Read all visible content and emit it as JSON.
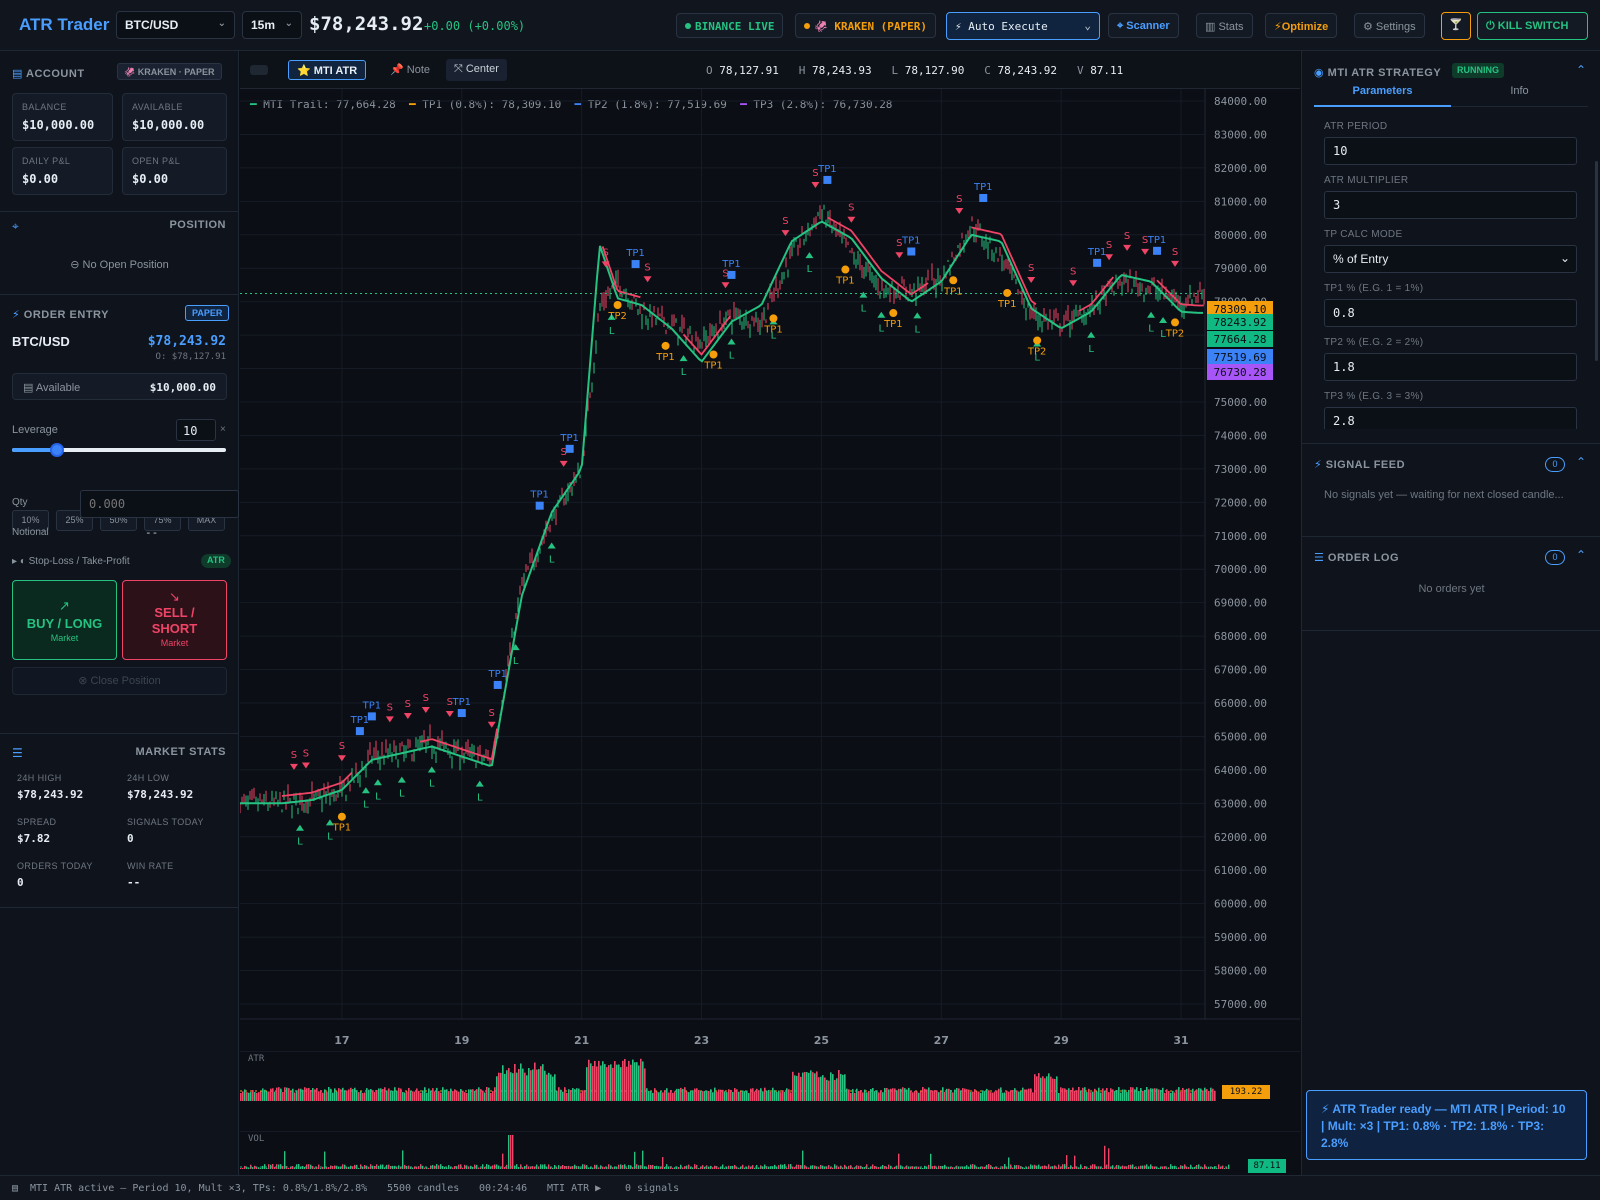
{
  "app": {
    "title": "ATR Trader",
    "symbol": "BTC/USD",
    "timeframe": "15m",
    "price": "$78,243.92",
    "change": "+0.00 (+0.00%)"
  },
  "top": {
    "binance": "BINANCE LIVE",
    "kraken": "KRAKEN (PAPER)",
    "auto_execute": "⚡ Auto Execute",
    "scanner": "Scanner",
    "stats": "Stats",
    "optimize": "Optimize",
    "settings": "Settings",
    "kill": "KILL SWITCH"
  },
  "account": {
    "title": "ACCOUNT",
    "badge": "KRAKEN · PAPER",
    "balance_l": "BALANCE",
    "balance": "$10,000.00",
    "avail_l": "AVAILABLE",
    "avail": "$10,000.00",
    "dpl_l": "DAILY P&L",
    "dpl": "$0.00",
    "opl_l": "OPEN P&L",
    "opl": "$0.00"
  },
  "position": {
    "title": "POSITION",
    "empty": "No Open Position"
  },
  "order": {
    "title": "ORDER ENTRY",
    "badge": "PAPER",
    "symbol": "BTC/USD",
    "price": "$78,243.92",
    "open": "O: $78,127.91",
    "available_l": "Available",
    "available": "$10,000.00",
    "leverage_l": "Leverage",
    "leverage": "10",
    "leverage_unit": "×",
    "pcts": [
      "10%",
      "25%",
      "50%",
      "75%",
      "MAX"
    ],
    "qty_l": "Qty",
    "qty_ph": "0.000",
    "notional_l": "Notional",
    "notional": "--",
    "sltp": "Stop-Loss / Take-Profit",
    "atr": "ATR",
    "buy": "BUY / LONG",
    "buy_sub": "Market",
    "sell1": "SELL /",
    "sell2": "SHORT",
    "sell_sub": "Market",
    "close": "Close Position"
  },
  "market": {
    "title": "MARKET STATS",
    "h_l": "24H HIGH",
    "h": "$78,243.92",
    "lo_l": "24H LOW",
    "lo": "$78,243.92",
    "sp_l": "SPREAD",
    "sp": "$7.82",
    "sig_l": "SIGNALS TODAY",
    "sig": "0",
    "ord_l": "ORDERS TODAY",
    "ord": "0",
    "wr_l": "WIN RATE",
    "wr": "--"
  },
  "toolbar": {
    "mti": "MTI ATR",
    "note": "Note",
    "center": "Center",
    "o_l": "O",
    "o": "78,127.91",
    "h_l": "H",
    "h": "78,243.93",
    "l_l": "L",
    "l": "78,127.90",
    "c_l": "C",
    "c": "78,243.92",
    "v_l": "V",
    "v": "87.11"
  },
  "legend": {
    "trail": "MTI Trail: 77,664.28",
    "tp1": "TP1 (0.8%): 78,309.10",
    "tp2": "TP2 (1.8%): 77,519.69",
    "tp3": "TP3 (2.8%): 76,730.28"
  },
  "axis": {
    "y": [
      "84000.00",
      "83000.00",
      "82000.00",
      "81000.00",
      "80000.00",
      "79000.00",
      "78000.00",
      "77000.00",
      "76000.00",
      "75000.00",
      "74000.00",
      "73000.00",
      "72000.00",
      "71000.00",
      "70000.00",
      "69000.00",
      "68000.00",
      "67000.00",
      "66000.00",
      "65000.00",
      "64000.00",
      "63000.00",
      "62000.00",
      "61000.00",
      "60000.00",
      "59000.00",
      "58000.00",
      "57000.00"
    ],
    "x": [
      "17",
      "19",
      "21",
      "23",
      "25",
      "27",
      "29",
      "31"
    ]
  },
  "tags": [
    {
      "t": "78309.10",
      "c": "#f59e0b"
    },
    {
      "t": "78243.92",
      "c": "#10b981"
    },
    {
      "t": "77664.28",
      "c": "#10b981"
    },
    {
      "t": "77519.69",
      "c": "#3b82f6"
    },
    {
      "t": "76730.28",
      "c": "#a855f7"
    }
  ],
  "atr": {
    "label": "ATR",
    "value": "193.22"
  },
  "vol": {
    "label": "VOL",
    "value": "87.11"
  },
  "strategy": {
    "title": "MTI ATR STRATEGY",
    "state": "RUNNING",
    "tab1": "Parameters",
    "tab2": "Info",
    "p_l": "ATR PERIOD",
    "p": "10",
    "m_l": "ATR MULTIPLIER",
    "m": "3",
    "mode_l": "TP CALC MODE",
    "mode": "% of Entry",
    "t1_l": "TP1 % (E.G. 1 = 1%)",
    "t1": "0.8",
    "t2_l": "TP2 % (E.G. 2 = 2%)",
    "t2": "1.8",
    "t3_l": "TP3 % (E.G. 3 = 3%)",
    "t3": "2.8"
  },
  "signals": {
    "title": "SIGNAL FEED",
    "count": "0",
    "empty": "No signals yet — waiting for next closed candle..."
  },
  "orders": {
    "title": "ORDER LOG",
    "count": "0",
    "empty": "No orders yet"
  },
  "toast": "⚡ ATR Trader ready — MTI ATR | Period: 10 | Mult: ×3 | TP1: 0.8% · TP2: 1.8% · TP3: 2.8%",
  "status": {
    "s1": "MTI ATR active — Period 10, Mult ×3, TPs: 0.8%/1.8%/2.8%",
    "s2": "5500 candles",
    "s3": "00:24:46",
    "s4": "MTI ATR ▶",
    "s5": "0 signals"
  },
  "colors": {
    "up": "#26c281",
    "down": "#ef4466",
    "accent": "#4a9eff",
    "tp1": "#f59e0b",
    "tp2": "#3b82f6",
    "tp3": "#a855f7"
  },
  "chart_data": {
    "type": "line",
    "x": [
      "16",
      "16.5",
      "17",
      "17.5",
      "18",
      "18.5",
      "19",
      "19.5",
      "20",
      "20.5",
      "21",
      "21.3",
      "21.6",
      "22",
      "22.5",
      "23",
      "23.5",
      "24",
      "24.5",
      "25",
      "25.5",
      "26",
      "26.5",
      "27",
      "27.5",
      "28",
      "28.5",
      "29",
      "29.5",
      "30",
      "30.5",
      "31",
      "31.3"
    ],
    "close": [
      63000,
      63100,
      63300,
      64400,
      64500,
      64800,
      64500,
      64300,
      69500,
      71500,
      73000,
      77800,
      78600,
      77700,
      77300,
      76800,
      77600,
      77400,
      79400,
      80700,
      79400,
      78400,
      78300,
      78700,
      80300,
      79300,
      77600,
      77300,
      77800,
      78600,
      78400,
      78000,
      78243.92
    ],
    "trail": [
      63000,
      63100,
      63400,
      64300,
      64500,
      64700,
      64400,
      64100,
      69200,
      71700,
      73000,
      79700,
      78100,
      77900,
      77200,
      76200,
      77400,
      77900,
      79800,
      80400,
      79900,
      78700,
      78000,
      78600,
      80000,
      79800,
      77800,
      77200,
      77700,
      78800,
      78600,
      77700,
      77664.28
    ],
    "ylim": [
      57000,
      84000
    ],
    "ylabel": "",
    "xlabel": ""
  }
}
